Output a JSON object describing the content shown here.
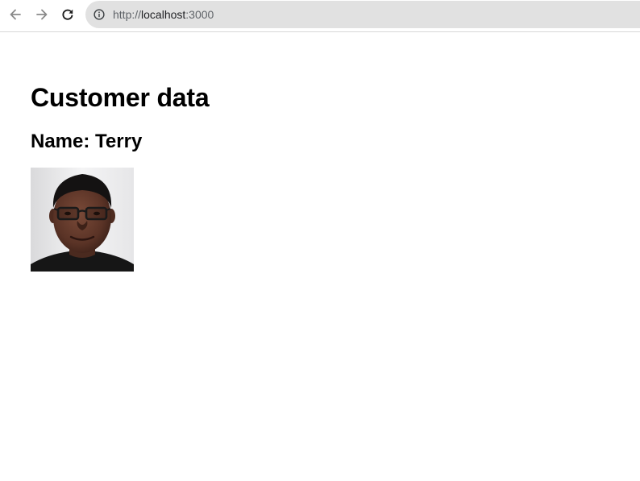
{
  "browser": {
    "url_prefix": "http://",
    "url_host": "localhost",
    "url_port": ":3000"
  },
  "page": {
    "title": "Customer data",
    "customer": {
      "name_label": "Name:",
      "name_value": "Terry"
    }
  },
  "icons": {
    "back": "arrow-left-icon",
    "forward": "arrow-right-icon",
    "reload": "reload-icon",
    "info": "info-circle-icon"
  }
}
